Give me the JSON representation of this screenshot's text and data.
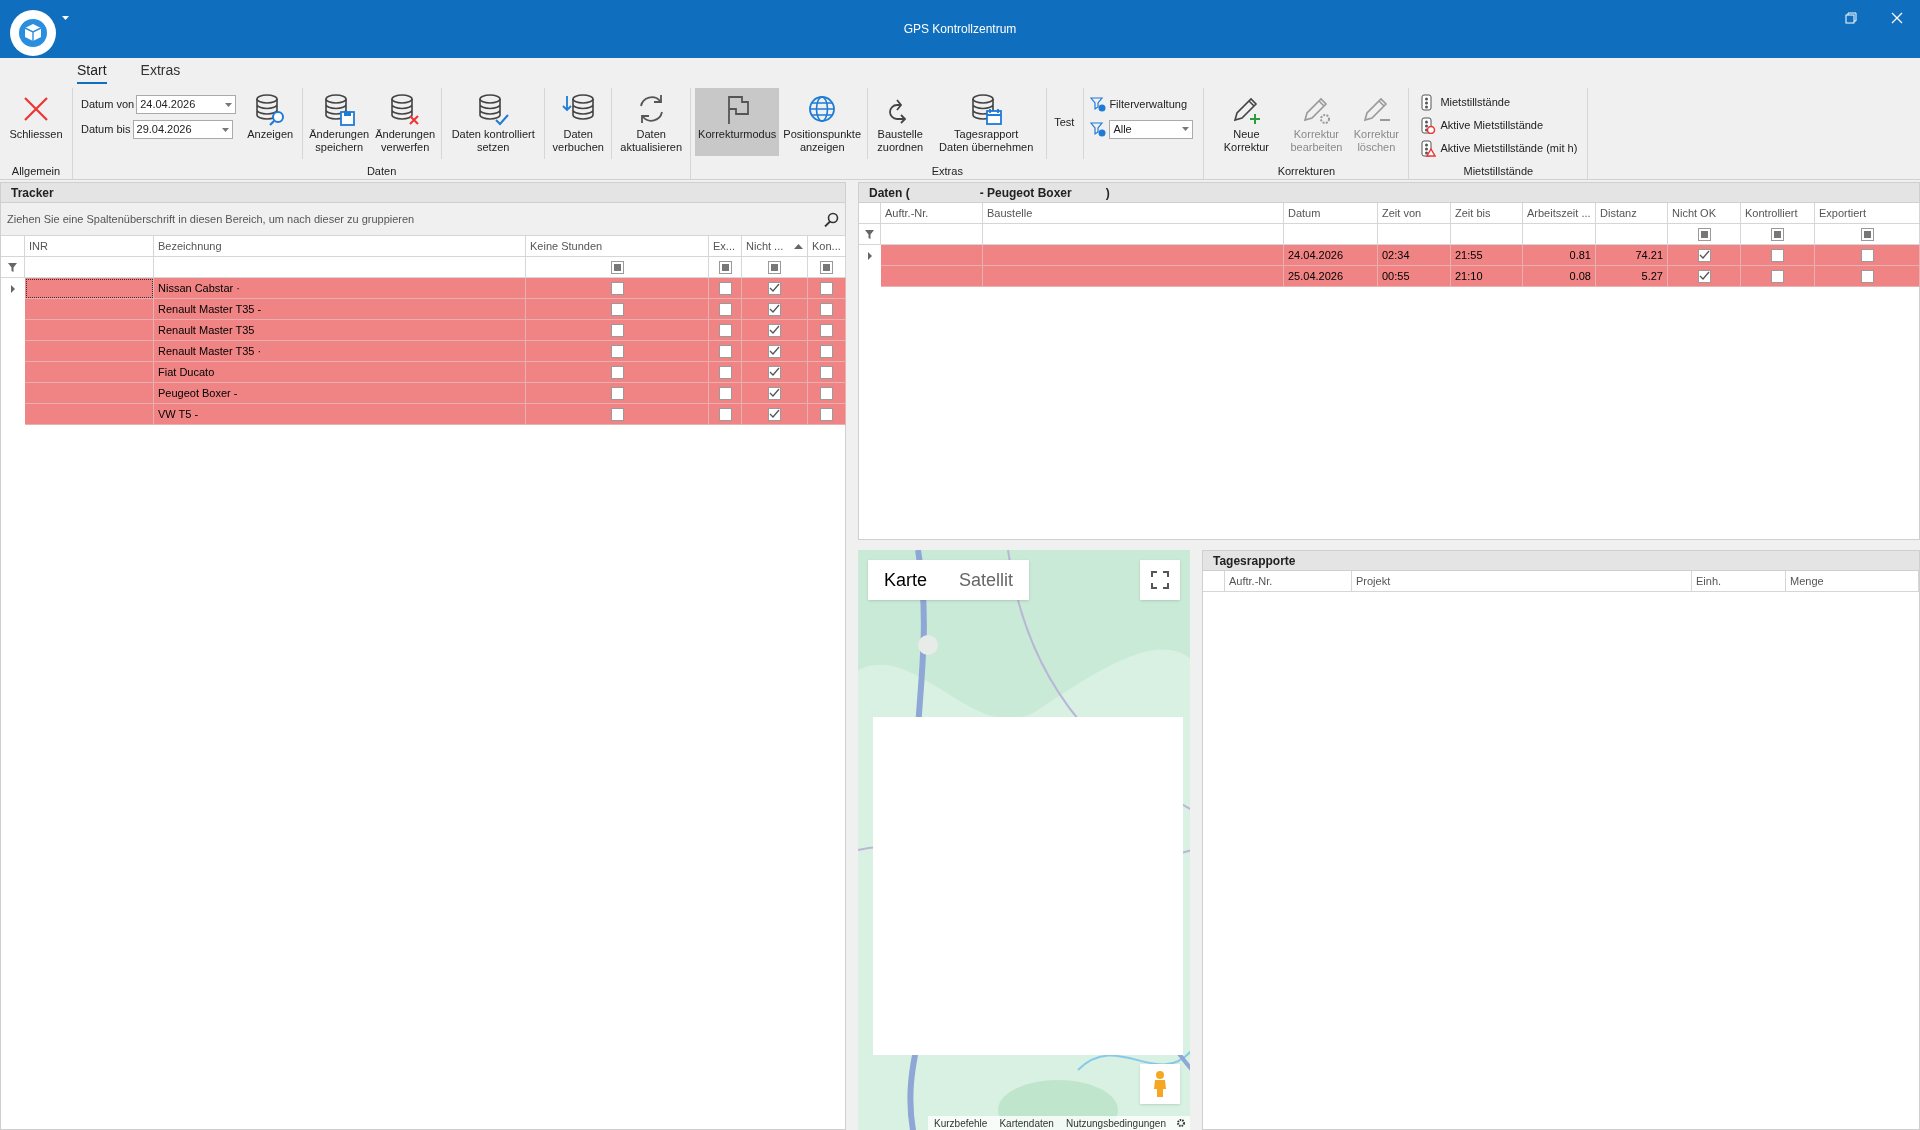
{
  "window": {
    "title": "GPS Kontrollzentrum"
  },
  "ribbon_tabs": [
    {
      "label": "Start",
      "selected": true
    },
    {
      "label": "Extras",
      "selected": false
    }
  ],
  "ribbon_groups": [
    {
      "label": "Allgemein",
      "items": [
        {
          "kind": "large",
          "label": "Schliessen",
          "disabled": false,
          "pressed": false
        }
      ]
    },
    {
      "label": "Daten",
      "items": [
        {
          "kind": "dates",
          "fields": [
            {
              "label": "Datum von",
              "value": "24.04.2026"
            },
            {
              "label": "Datum bis",
              "value": "29.04.2026"
            }
          ]
        },
        {
          "kind": "large",
          "label": "Anzeigen",
          "disabled": false,
          "pressed": false
        },
        {
          "kind": "large",
          "label": "Änderungen speichern",
          "disabled": false,
          "pressed": false
        },
        {
          "kind": "large",
          "label": "Änderungen verwerfen",
          "disabled": false,
          "pressed": false
        },
        {
          "kind": "large",
          "label": "Daten kontrolliert setzen",
          "disabled": false,
          "pressed": false
        },
        {
          "kind": "large",
          "label": "Daten verbuchen",
          "disabled": false,
          "pressed": false
        },
        {
          "kind": "large",
          "label": "Daten aktualisieren",
          "disabled": false,
          "pressed": false
        }
      ]
    },
    {
      "label": "Extras",
      "items": [
        {
          "kind": "large",
          "label": "Korrekturmodus",
          "disabled": false,
          "pressed": true
        },
        {
          "kind": "large",
          "label": "Positionspunkte anzeigen",
          "disabled": false,
          "pressed": false
        },
        {
          "kind": "large",
          "label": "Baustelle zuordnen",
          "disabled": false,
          "pressed": false
        },
        {
          "kind": "large",
          "label": "Tagesrapport Daten übernehmen",
          "disabled": false,
          "pressed": false
        },
        {
          "kind": "text",
          "label": "Test"
        },
        {
          "kind": "filters",
          "label": "Filterverwaltung",
          "value": "Alle"
        }
      ]
    },
    {
      "label": "Korrekturen",
      "items": [
        {
          "kind": "large",
          "label": "Neue Korrektur",
          "disabled": false,
          "pressed": false
        },
        {
          "kind": "large",
          "label": "Korrektur bearbeiten",
          "disabled": true,
          "pressed": false
        },
        {
          "kind": "large",
          "label": "Korrektur löschen",
          "disabled": true,
          "pressed": false
        }
      ]
    },
    {
      "label": "Mietstillstände",
      "items": [
        {
          "kind": "small_list",
          "entries": [
            "Mietstillstände",
            "Aktive Mietstillstände",
            "Aktive Mietstillstände (mit h)"
          ]
        }
      ]
    }
  ],
  "tracker": {
    "title": "Tracker",
    "group_hint": "Ziehen Sie eine Spaltenüberschrift in diesen Bereich, um nach dieser zu gruppieren",
    "columns": [
      {
        "label": "INR"
      },
      {
        "label": "Bezeichnung"
      },
      {
        "label": "Keine Stunden",
        "filter_mixed": true
      },
      {
        "label": "Ex...",
        "filter_mixed": true
      },
      {
        "label": "Nicht ...",
        "filter_mixed": true
      },
      {
        "label": "Kon...",
        "filter_mixed": true
      }
    ],
    "rows": [
      {
        "current": true,
        "bezeichnung": "Nissan Cabstar ·",
        "keine_stunden": false,
        "ex": false,
        "nicht": true,
        "kon": false
      },
      {
        "current": false,
        "bezeichnung": "Renault Master T35 -",
        "keine_stunden": false,
        "ex": false,
        "nicht": true,
        "kon": false
      },
      {
        "current": false,
        "bezeichnung": "Renault Master T35",
        "keine_stunden": false,
        "ex": false,
        "nicht": true,
        "kon": false
      },
      {
        "current": false,
        "bezeichnung": "Renault Master T35 ·",
        "keine_stunden": false,
        "ex": false,
        "nicht": true,
        "kon": false
      },
      {
        "current": false,
        "bezeichnung": "Fiat Ducato",
        "keine_stunden": false,
        "ex": false,
        "nicht": true,
        "kon": false
      },
      {
        "current": false,
        "bezeichnung": "Peugeot Boxer -",
        "keine_stunden": false,
        "ex": false,
        "nicht": true,
        "kon": false
      },
      {
        "current": false,
        "bezeichnung": "VW T5 -",
        "keine_stunden": false,
        "ex": false,
        "nicht": true,
        "kon": false
      }
    ]
  },
  "daten": {
    "title_parts": [
      "Daten (",
      "- Peugeot Boxer",
      ")"
    ],
    "columns": [
      {
        "label": "Auftr.-Nr."
      },
      {
        "label": "Baustelle"
      },
      {
        "label": "Datum"
      },
      {
        "label": "Zeit von"
      },
      {
        "label": "Zeit bis"
      },
      {
        "label": "Arbeitszeit ..."
      },
      {
        "label": "Distanz"
      },
      {
        "label": "Nicht OK",
        "filter_mixed": true
      },
      {
        "label": "Kontrolliert",
        "filter_mixed": true
      },
      {
        "label": "Exportiert",
        "filter_mixed": true
      }
    ],
    "rows": [
      {
        "current": true,
        "datum": "24.04.2026",
        "zeit_von": "02:34",
        "zeit_bis": "21:55",
        "arbeitszeit": "0.81",
        "distanz": "74.21",
        "nicht_ok": true,
        "kontrolliert": false,
        "exportiert": false
      },
      {
        "current": false,
        "datum": "25.04.2026",
        "zeit_von": "00:55",
        "zeit_bis": "21:10",
        "arbeitszeit": "0.08",
        "distanz": "5.27",
        "nicht_ok": true,
        "kontrolliert": false,
        "exportiert": false
      }
    ]
  },
  "map": {
    "kind": "picture",
    "map_types": [
      {
        "label": "Karte",
        "selected": true
      },
      {
        "label": "Satellit",
        "selected": false
      }
    ],
    "footer_links": [
      "Kurzbefehle",
      "Kartendaten",
      "Nutzungsbedingungen"
    ]
  },
  "tagesrapporte": {
    "title": "Tagesrapporte",
    "columns": [
      "Auftr.-Nr.",
      "Projekt",
      "Einh.",
      "Menge"
    ]
  }
}
